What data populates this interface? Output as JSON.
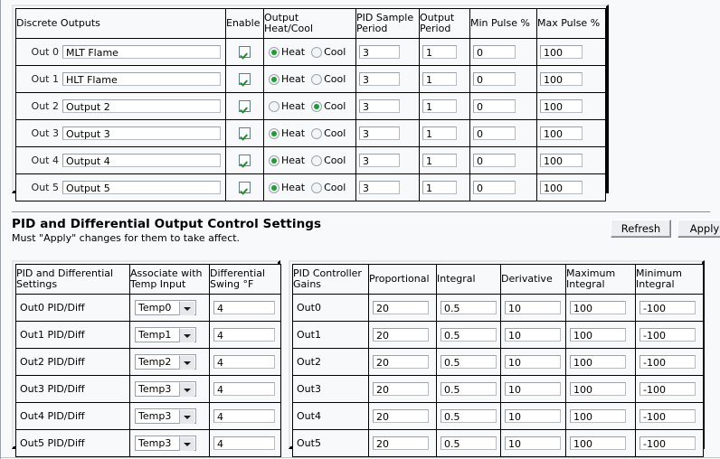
{
  "discrete_outputs": {
    "headers": {
      "name": "Discrete Outputs",
      "enable": "Enable",
      "heat_cool": "Output\nHeat/Cool",
      "pid_sample_period": "PID Sample\nPeriod",
      "output_period": "Output\nPeriod",
      "min_pulse": "Min Pulse %",
      "max_pulse": "Max Pulse %"
    },
    "radio_labels": {
      "heat": "Heat",
      "cool": "Cool"
    },
    "rows": [
      {
        "index": "Out 0",
        "name": "MLT Flame",
        "enabled": true,
        "mode": "heat",
        "pid_sample_period": "3",
        "output_period": "1",
        "min_pulse": "0",
        "max_pulse": "100"
      },
      {
        "index": "Out 1",
        "name": "HLT Flame",
        "enabled": true,
        "mode": "heat",
        "pid_sample_period": "3",
        "output_period": "1",
        "min_pulse": "0",
        "max_pulse": "100"
      },
      {
        "index": "Out 2",
        "name": "Output 2",
        "enabled": true,
        "mode": "cool",
        "pid_sample_period": "3",
        "output_period": "1",
        "min_pulse": "0",
        "max_pulse": "100"
      },
      {
        "index": "Out 3",
        "name": "Output 3",
        "enabled": true,
        "mode": "heat",
        "pid_sample_period": "3",
        "output_period": "1",
        "min_pulse": "0",
        "max_pulse": "100"
      },
      {
        "index": "Out 4",
        "name": "Output 4",
        "enabled": true,
        "mode": "heat",
        "pid_sample_period": "3",
        "output_period": "1",
        "min_pulse": "0",
        "max_pulse": "100"
      },
      {
        "index": "Out 5",
        "name": "Output 5",
        "enabled": true,
        "mode": "heat",
        "pid_sample_period": "3",
        "output_period": "1",
        "min_pulse": "0",
        "max_pulse": "100"
      }
    ]
  },
  "section": {
    "title": "PID and Differential Output Control Settings",
    "subtitle": "Must \"Apply\" changes for them to take affect.",
    "refresh_label": "Refresh",
    "apply_label": "Apply"
  },
  "pid_diff": {
    "headers": {
      "settings": "PID and Differential\nSettings",
      "associate": "Associate with\nTemp Input",
      "swing": "Differential\nSwing °F"
    },
    "rows": [
      {
        "label": "Out0 PID/Diff",
        "temp_input": "Temp0",
        "swing": "4"
      },
      {
        "label": "Out1 PID/Diff",
        "temp_input": "Temp1",
        "swing": "4"
      },
      {
        "label": "Out2 PID/Diff",
        "temp_input": "Temp2",
        "swing": "4"
      },
      {
        "label": "Out3 PID/Diff",
        "temp_input": "Temp3",
        "swing": "4"
      },
      {
        "label": "Out4 PID/Diff",
        "temp_input": "Temp3",
        "swing": "4"
      },
      {
        "label": "Out5 PID/Diff",
        "temp_input": "Temp3",
        "swing": "4"
      }
    ]
  },
  "pid_gains": {
    "headers": {
      "gains": "PID Controller\nGains",
      "proportional": "Proportional",
      "integral": "Integral",
      "derivative": "Derivative",
      "max_integral": "Maximum\nIntegral",
      "min_integral": "Minimum\nIntegral"
    },
    "rows": [
      {
        "label": "Out0",
        "proportional": "20",
        "integral": "0.5",
        "derivative": "10",
        "max_integral": "100",
        "min_integral": "-100"
      },
      {
        "label": "Out1",
        "proportional": "20",
        "integral": "0.5",
        "derivative": "10",
        "max_integral": "100",
        "min_integral": "-100"
      },
      {
        "label": "Out2",
        "proportional": "20",
        "integral": "0.5",
        "derivative": "10",
        "max_integral": "100",
        "min_integral": "-100"
      },
      {
        "label": "Out3",
        "proportional": "20",
        "integral": "0.5",
        "derivative": "10",
        "max_integral": "100",
        "min_integral": "-100"
      },
      {
        "label": "Out4",
        "proportional": "20",
        "integral": "0.5",
        "derivative": "10",
        "max_integral": "100",
        "min_integral": "-100"
      },
      {
        "label": "Out5",
        "proportional": "20",
        "integral": "0.5",
        "derivative": "10",
        "max_integral": "100",
        "min_integral": "-100"
      }
    ]
  },
  "colors": {
    "check_green": "#1a8f2a",
    "radio_green": "#1f9c33",
    "page_background": "#f8f9fb",
    "border_dark": "#000000"
  }
}
